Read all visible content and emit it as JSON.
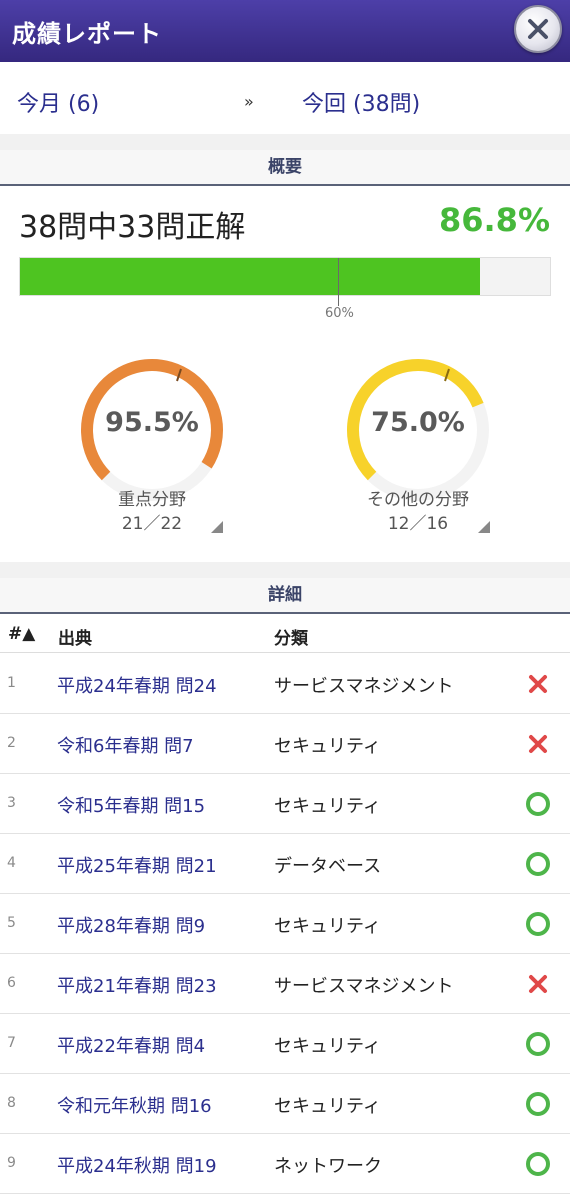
{
  "header": {
    "title": "成績レポート"
  },
  "nav": {
    "month": "今月 (6)",
    "arrow": "»",
    "current": "今回 (38問)"
  },
  "summary": {
    "section_title": "概要",
    "score_text": "38問中33問正解",
    "score_percent": "86.8%",
    "progress_fraction": 0.868,
    "threshold_fraction": 0.6,
    "threshold_label": "60%"
  },
  "gauges": [
    {
      "value": "95.5%",
      "fraction": 0.955,
      "name": "重点分野",
      "count": "21／22",
      "color": "#e8883a"
    },
    {
      "value": "75.0%",
      "fraction": 0.75,
      "name": "その他の分野",
      "count": "12／16",
      "color": "#f7d22a"
    }
  ],
  "details": {
    "section_title": "詳細",
    "columns": [
      "#▲",
      "出典",
      "分類"
    ],
    "rows": [
      {
        "num": "1",
        "source": "平成24年春期 問24",
        "category": "サービスマネジメント",
        "result": "wrong"
      },
      {
        "num": "2",
        "source": "令和6年春期 問7",
        "category": "セキュリティ",
        "result": "wrong"
      },
      {
        "num": "3",
        "source": "令和5年春期 問15",
        "category": "セキュリティ",
        "result": "correct"
      },
      {
        "num": "4",
        "source": "平成25年春期 問21",
        "category": "データベース",
        "result": "correct"
      },
      {
        "num": "5",
        "source": "平成28年春期 問9",
        "category": "セキュリティ",
        "result": "correct"
      },
      {
        "num": "6",
        "source": "平成21年春期 問23",
        "category": "サービスマネジメント",
        "result": "wrong"
      },
      {
        "num": "7",
        "source": "平成22年春期 問4",
        "category": "セキュリティ",
        "result": "correct"
      },
      {
        "num": "8",
        "source": "令和元年秋期 問16",
        "category": "セキュリティ",
        "result": "correct"
      },
      {
        "num": "9",
        "source": "平成24年秋期 問19",
        "category": "ネットワーク",
        "result": "correct"
      }
    ]
  },
  "colors": {
    "header": "#3b2e8e",
    "correct": "#4eb54a",
    "wrong": "#e04848",
    "progress": "#4ec421"
  }
}
